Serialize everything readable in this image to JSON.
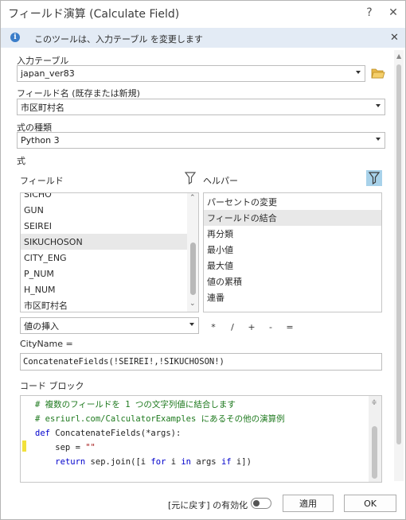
{
  "window": {
    "title": "フィールド演算 (Calculate Field)",
    "help_glyph": "?",
    "close_glyph": "✕"
  },
  "info_bar": {
    "icon_glyph": "i",
    "message": "このツールは、入力テーブル を変更します",
    "close_glyph": "✕"
  },
  "params": {
    "input_table": {
      "label": "入力テーブル",
      "value": "japan_ver83"
    },
    "field_name": {
      "label": "フィールド名 (既存または新規)",
      "value": "市区町村名"
    },
    "expression_type": {
      "label": "式の種類",
      "value": "Python 3"
    },
    "expression_label": "式"
  },
  "fields_panel": {
    "label": "フィールド",
    "items": [
      "SICHO",
      "GUN",
      "SEIREI",
      "SIKUCHOSON",
      "CITY_ENG",
      "P_NUM",
      "H_NUM",
      "市区町村名"
    ],
    "selected": "SIKUCHOSON"
  },
  "helpers_panel": {
    "label": "ヘルパー",
    "items": [
      "パーセントの変更",
      "フィールドの結合",
      "再分類",
      "最小値",
      "最大値",
      "値の累積",
      "連番"
    ],
    "selected": "フィールドの結合"
  },
  "insert_values": {
    "value": "値の挿入"
  },
  "operators": [
    "*",
    "/",
    "+",
    "-",
    "="
  ],
  "expression": {
    "label": "CityName =",
    "value": "ConcatenateFields(!SEIREI!,!SIKUCHOSON!)"
  },
  "code_block": {
    "label": "コード ブロック",
    "lines": [
      {
        "parts": [
          {
            "t": "# 複数のフィールドを 1 つの文字列値に結合します",
            "c": "cmt"
          }
        ]
      },
      {
        "parts": [
          {
            "t": "# esriurl.com/CalculatorExamples にあるその他の演算例",
            "c": "cmt"
          }
        ]
      },
      {
        "parts": [
          {
            "t": "def",
            "c": "kw"
          },
          {
            "t": " ConcatenateFields(*args):",
            "c": ""
          }
        ]
      },
      {
        "parts": [
          {
            "t": "    sep = ",
            "c": ""
          },
          {
            "t": "\"\"",
            "c": "str"
          }
        ]
      },
      {
        "parts": [
          {
            "t": "    ",
            "c": ""
          },
          {
            "t": "return",
            "c": "kw"
          },
          {
            "t": " sep.join([i ",
            "c": ""
          },
          {
            "t": "for",
            "c": "kw"
          },
          {
            "t": " i ",
            "c": ""
          },
          {
            "t": "in",
            "c": "kw"
          },
          {
            "t": " args ",
            "c": ""
          },
          {
            "t": "if",
            "c": "kw"
          },
          {
            "t": " i])",
            "c": ""
          }
        ]
      }
    ]
  },
  "footer": {
    "undo_toggle_label": "[元に戻す] の有効化",
    "apply_label": "適用",
    "ok_label": "OK"
  },
  "colors": {
    "info_bg": "#e3ebf5",
    "info_icon": "#3a7dc9",
    "selected_row": "#e8e8e8",
    "helper_filter_active": "#a8d2ea",
    "comment": "#1f7a1f",
    "keyword": "#0000cc",
    "string": "#a31515",
    "change_marker": "#f2e13b"
  }
}
